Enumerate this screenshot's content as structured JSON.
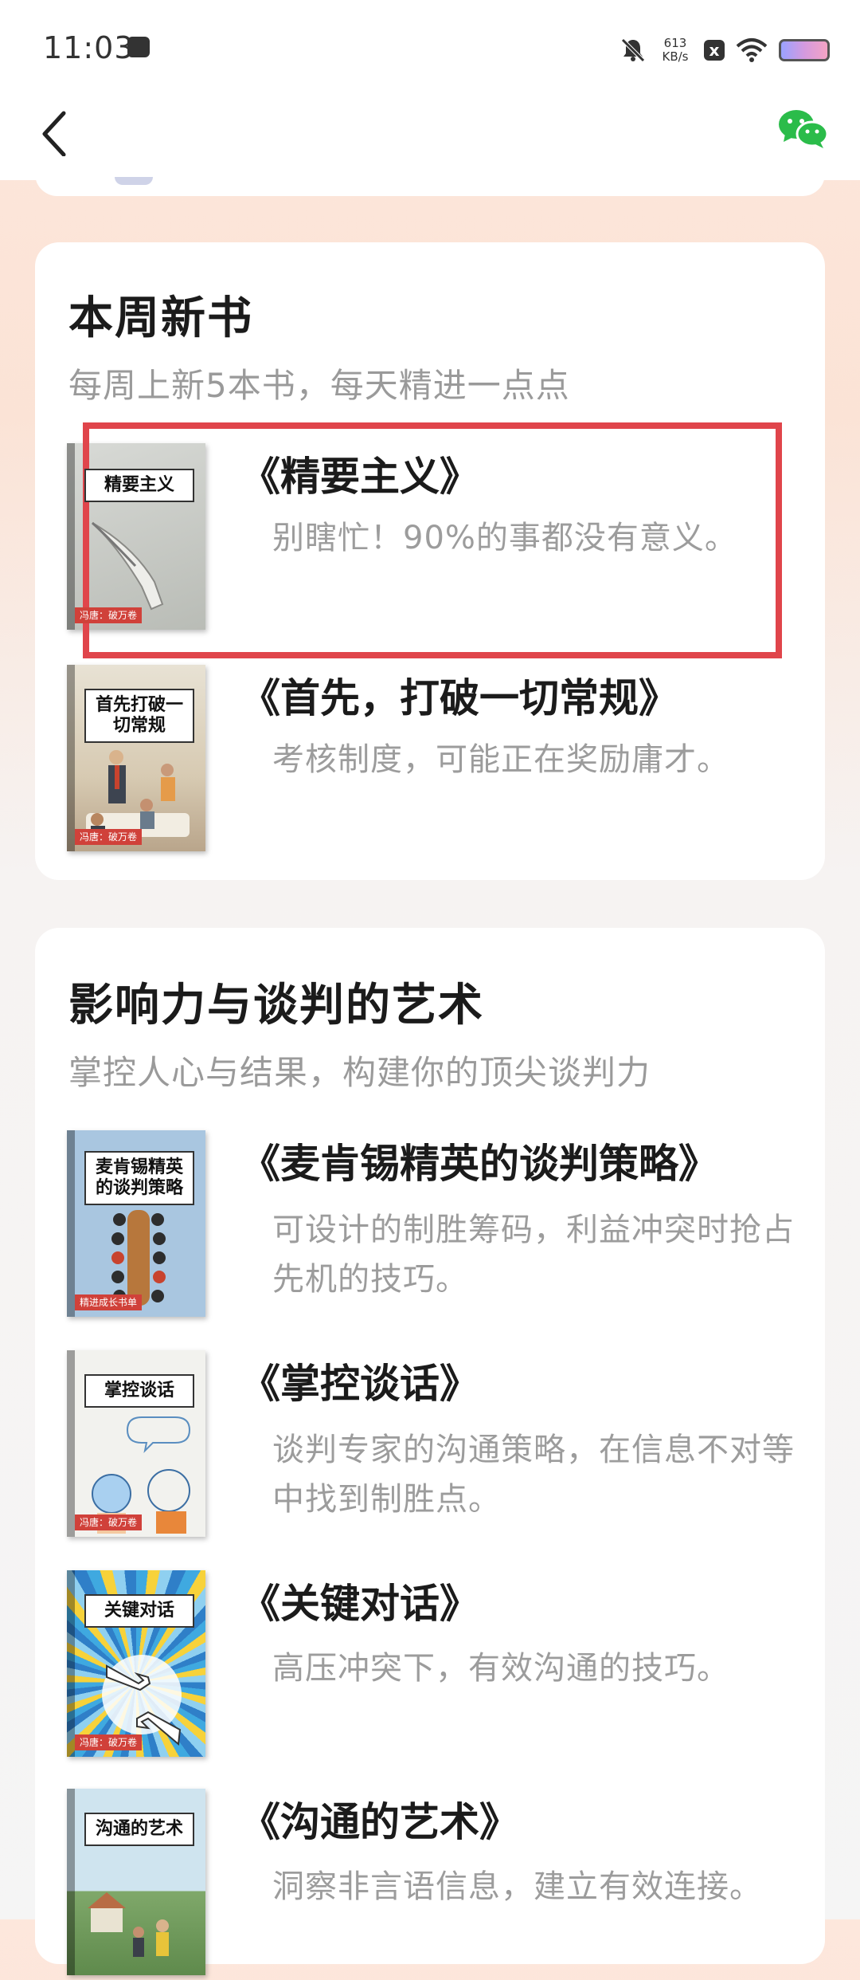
{
  "status_bar": {
    "time": "11:03",
    "net_speed_value": "613",
    "net_speed_unit": "KB/s",
    "x_label": "x"
  },
  "nav": {
    "back_icon": "chevron-left-icon",
    "share_icon": "wechat-icon",
    "brand_color": "#2bbc4a"
  },
  "sections": [
    {
      "title": "本周新书",
      "subtitle": "每周上新5本书，每天精进一点点",
      "books": [
        {
          "title": "《精要主义》",
          "desc": "别瞎忙！90%的事都没有意义。",
          "cover_label": "精要主义",
          "cover_tag": "冯唐：破万卷"
        },
        {
          "title": "《首先，打破一切常规》",
          "desc": "考核制度，可能正在奖励庸才。",
          "cover_label": "首先打破一切常规",
          "cover_tag": "冯唐：破万卷"
        }
      ]
    },
    {
      "title": "影响力与谈判的艺术",
      "subtitle": "掌控人心与结果，构建你的顶尖谈判力",
      "books": [
        {
          "title": "《麦肯锡精英的谈判策略》",
          "desc": "可设计的制胜筹码，利益冲突时抢占先机的技巧。",
          "cover_label": "麦肯锡精英的谈判策略",
          "cover_tag": "精进成长书单"
        },
        {
          "title": "《掌控谈话》",
          "desc": "谈判专家的沟通策略，在信息不对等中找到制胜点。",
          "cover_label": "掌控谈话",
          "cover_tag": "冯唐：破万卷"
        },
        {
          "title": "《关键对话》",
          "desc": "高压冲突下，有效沟通的技巧。",
          "cover_label": "关键对话",
          "cover_tag": "冯唐：破万卷"
        },
        {
          "title": "《沟通的艺术》",
          "desc": "洞察非言语信息，建立有效连接。",
          "cover_label": "沟通的艺术",
          "cover_tag": ""
        }
      ]
    }
  ],
  "highlight_color": "#e0454b"
}
